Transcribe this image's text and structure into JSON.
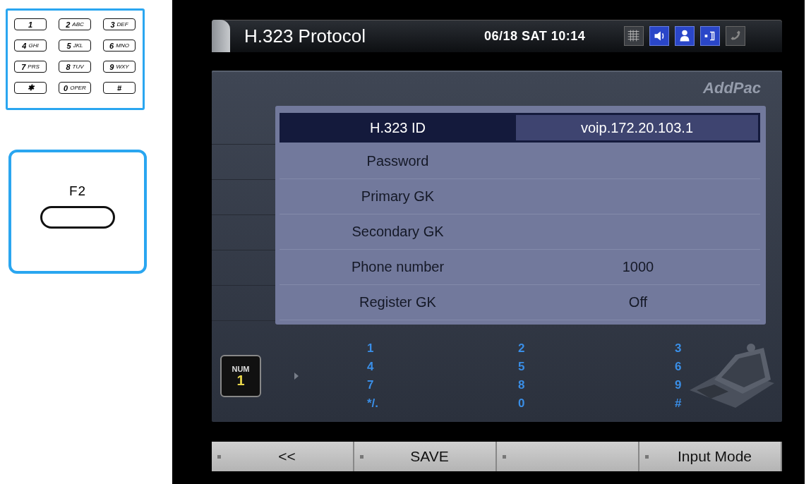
{
  "keypad": {
    "keys": [
      {
        "digit": "1"
      },
      {
        "digit": "2",
        "letters": "ABC"
      },
      {
        "digit": "3",
        "letters": "DEF"
      },
      {
        "digit": "4",
        "letters": "GHI"
      },
      {
        "digit": "5",
        "letters": "JKL"
      },
      {
        "digit": "6",
        "letters": "MNO"
      },
      {
        "digit": "7",
        "letters": "PRS"
      },
      {
        "digit": "8",
        "letters": "TUV"
      },
      {
        "digit": "9",
        "letters": "WXY"
      },
      {
        "digit": "✱"
      },
      {
        "digit": "0",
        "letters": "OPER"
      },
      {
        "digit": "#"
      }
    ]
  },
  "function_key": {
    "label": "F2"
  },
  "screen": {
    "title": "H.323 Protocol",
    "datetime": "06/18 SAT 10:14",
    "status_icons": [
      {
        "kind": "grid",
        "on": false
      },
      {
        "kind": "speaker",
        "on": true
      },
      {
        "kind": "person",
        "on": true
      },
      {
        "kind": "network",
        "on": true
      },
      {
        "kind": "handset",
        "on": false
      }
    ],
    "brand": "AddPac",
    "rows": [
      {
        "label": "H.323 ID",
        "value": "voip.172.20.103.1",
        "selected": true
      },
      {
        "label": "Password",
        "selected": false
      },
      {
        "label": "Primary GK",
        "selected": false
      },
      {
        "label": "Secondary GK",
        "selected": false
      },
      {
        "label": "Phone number",
        "value": "1000",
        "selected": false
      },
      {
        "label": "Register GK",
        "value": "Off",
        "selected": false
      }
    ],
    "input_mode": {
      "label": "NUM",
      "value": "1"
    },
    "char_map": [
      "1",
      "2",
      "3",
      "4",
      "5",
      "6",
      "7",
      "8",
      "9",
      "*/.",
      "0",
      "#"
    ],
    "softkeys": [
      {
        "kind": "labeled",
        "label": "<<"
      },
      {
        "kind": "labeled",
        "label": "SAVE"
      },
      {
        "kind": "blank"
      },
      {
        "kind": "labeled",
        "label": "Input Mode"
      }
    ]
  }
}
